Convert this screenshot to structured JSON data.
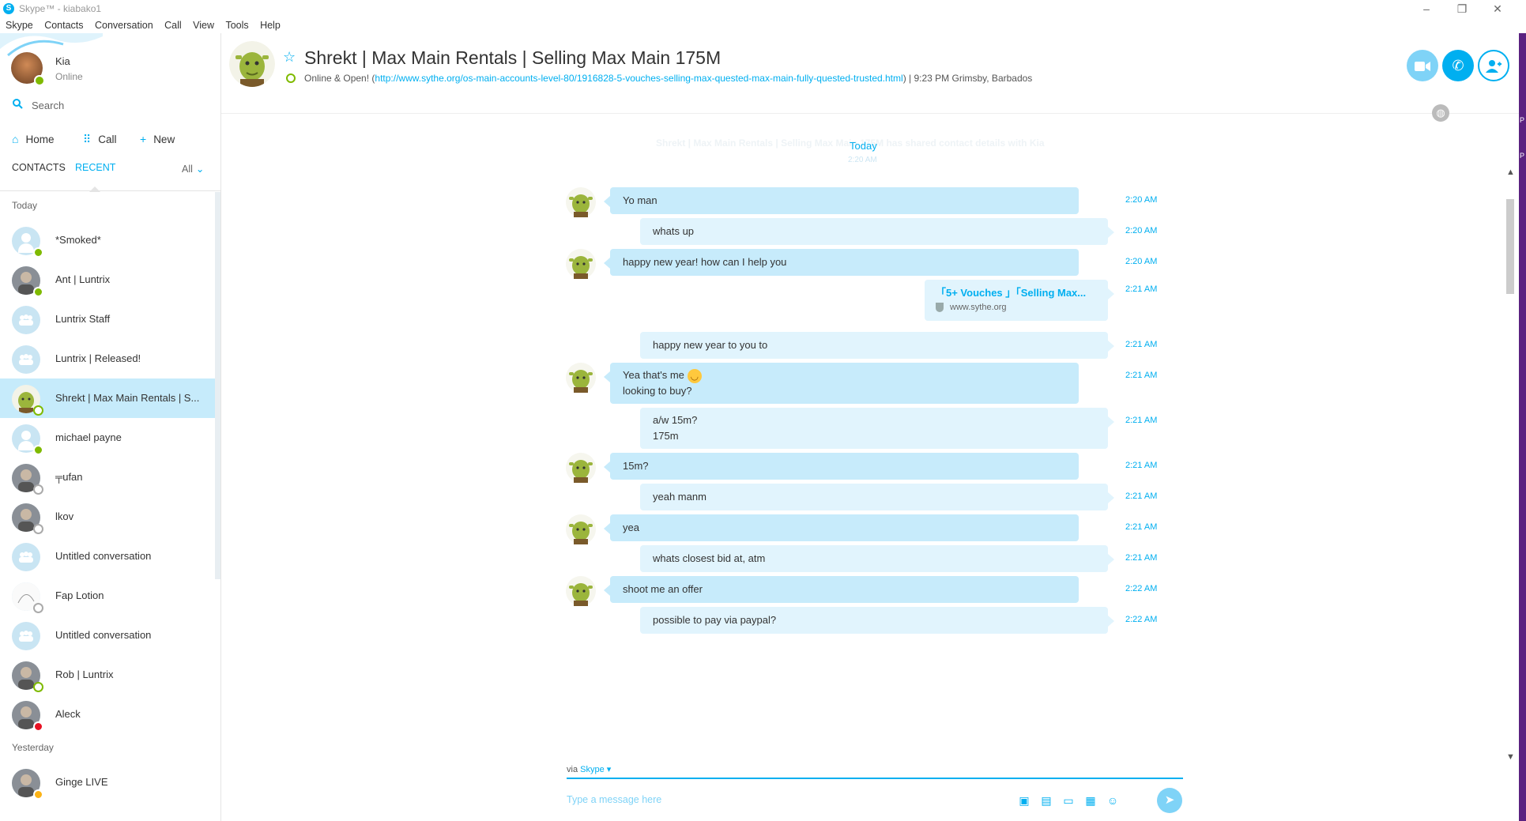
{
  "window": {
    "title": "Skype™ - kiabako1",
    "minimize": "–",
    "restore": "❐",
    "close": "✕"
  },
  "menu": [
    "Skype",
    "Contacts",
    "Conversation",
    "Call",
    "View",
    "Tools",
    "Help"
  ],
  "profile": {
    "name": "Kia",
    "status": "Online"
  },
  "search": {
    "label": "Search"
  },
  "nav": {
    "home": "Home",
    "call": "Call",
    "new": "New"
  },
  "tabs": {
    "contacts": "CONTACTS",
    "recent": "RECENT",
    "filter": "All"
  },
  "sections": {
    "today": "Today",
    "yesterday": "Yesterday"
  },
  "contacts_today": [
    {
      "name": "*Smoked*",
      "avatar": "person",
      "status": "online"
    },
    {
      "name": "Ant | Luntrix",
      "avatar": "photo",
      "status": "online"
    },
    {
      "name": "Luntrix Staff",
      "avatar": "group",
      "status": ""
    },
    {
      "name": "Luntrix | Released!",
      "avatar": "group",
      "status": ""
    },
    {
      "name": "Shrekt | Max Main Rentals | S...",
      "avatar": "shrek",
      "status": "ring",
      "active": true
    },
    {
      "name": "michael payne",
      "avatar": "person",
      "status": "online"
    },
    {
      "name": "╤ufan",
      "avatar": "photo",
      "status": "away"
    },
    {
      "name": "lkov",
      "avatar": "photo",
      "status": "away"
    },
    {
      "name": "Untitled conversation",
      "avatar": "group",
      "status": ""
    },
    {
      "name": "Fap Lotion",
      "avatar": "sketch",
      "status": "away"
    },
    {
      "name": "Untitled conversation",
      "avatar": "group",
      "status": ""
    },
    {
      "name": "Rob | Luntrix",
      "avatar": "photo",
      "status": "ring"
    },
    {
      "name": "Aleck",
      "avatar": "photo",
      "status": "dnd"
    }
  ],
  "contacts_yesterday": [
    {
      "name": "Ginge LIVE",
      "avatar": "photo",
      "status": "idle"
    }
  ],
  "conversation": {
    "title": "Shrekt | Max Main Rentals | Selling Max Main 175M",
    "mood_prefix": "Online & Open! (",
    "mood_link": "http://www.sythe.org/os-main-accounts-level-80/1916828-5-vouches-selling-max-quested-max-main-fully-quested-trusted.html",
    "mood_suffix": ")  |  9:23 PM Grimsby, Barbados",
    "shared_note": "Shrekt | Max Main Rentals | Selling Max Main 175M has shared contact details with Kia",
    "today": "Today",
    "today_time": "2:20 AM"
  },
  "messages": [
    {
      "dir": "in",
      "lines": [
        "Yo man"
      ],
      "time": "2:20 AM"
    },
    {
      "dir": "out",
      "lines": [
        "whats up"
      ],
      "time": "2:20 AM"
    },
    {
      "dir": "in",
      "lines": [
        "happy new year! how can I help you"
      ],
      "time": "2:20 AM"
    },
    {
      "dir": "link",
      "title": "「5+ Vouches 」「Selling Max...",
      "domain": "www.sythe.org",
      "time": "2:21 AM"
    },
    {
      "dir": "out",
      "lines": [
        "happy new year to you to"
      ],
      "time": "2:21 AM"
    },
    {
      "dir": "in",
      "lines": [
        "Yea that's me",
        "looking to buy?"
      ],
      "emoji": "smile-emoji",
      "time": "2:21 AM"
    },
    {
      "dir": "out",
      "lines": [
        "a/w 15m?",
        "175m"
      ],
      "time": "2:21 AM"
    },
    {
      "dir": "in",
      "lines": [
        "15m?"
      ],
      "time": "2:21 AM"
    },
    {
      "dir": "out",
      "lines": [
        "yeah manm"
      ],
      "time": "2:21 AM"
    },
    {
      "dir": "in",
      "lines": [
        "yea"
      ],
      "time": "2:21 AM"
    },
    {
      "dir": "out",
      "lines": [
        "whats closest bid at, atm"
      ],
      "time": "2:21 AM"
    },
    {
      "dir": "in",
      "lines": [
        "shoot me an offer"
      ],
      "time": "2:22 AM"
    },
    {
      "dir": "out",
      "lines": [
        "possible to pay via paypal?"
      ],
      "time": "2:22 AM"
    }
  ],
  "composer": {
    "via": "via",
    "via_service": "Skype",
    "placeholder": "Type a message here"
  },
  "colors": {
    "accent": "#00aff0",
    "bubble_in": "#c7ebfb",
    "bubble_out": "#e1f4fd",
    "online": "#7fba00",
    "dnd": "#e81123"
  },
  "icons": [
    "search-icon",
    "home-icon",
    "dialpad-icon",
    "plus-icon",
    "star-icon",
    "video-call-icon",
    "call-icon",
    "add-contact-icon",
    "globe-icon",
    "send-icon"
  ]
}
